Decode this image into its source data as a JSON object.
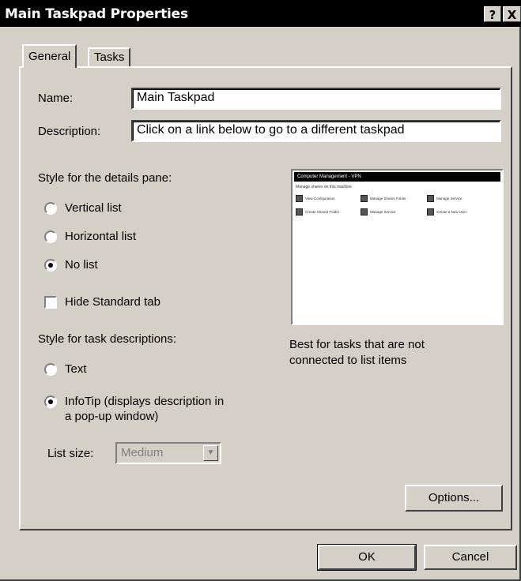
{
  "window": {
    "title": "Main Taskpad Properties",
    "help_label": "?",
    "close_label": "X"
  },
  "tabs": [
    {
      "label": "General",
      "selected": true
    },
    {
      "label": "Tasks",
      "selected": false
    }
  ],
  "name_field": {
    "label": "Name:",
    "value": "Main Taskpad"
  },
  "description_field": {
    "label": "Description:",
    "value": "Click on a link below to go to a different taskpad"
  },
  "details_pane": {
    "heading": "Style for the details pane:",
    "options": [
      {
        "label": "Vertical list",
        "selected": false
      },
      {
        "label": "Horizontal list",
        "selected": false
      },
      {
        "label": "No list",
        "selected": true
      }
    ],
    "hide_standard_tab": {
      "label": "Hide Standard tab",
      "checked": false
    }
  },
  "preview": {
    "title": "Computer Management - VPN",
    "subtitle": "Manage shares on this machine",
    "tasks": [
      "View Configuration",
      "Manage Shares Folder",
      "Manage Service",
      "Create Shared Folder",
      "Manage Service",
      "Create a New User"
    ],
    "caption_line1": "Best for tasks that are not",
    "caption_line2": "connected to list items"
  },
  "task_descriptions": {
    "heading": "Style for task descriptions:",
    "options": [
      {
        "label": "Text",
        "selected": false
      },
      {
        "label_line1": "InfoTip (displays description in",
        "label_line2": "a pop-up window)",
        "selected": true
      }
    ]
  },
  "list_size": {
    "label": "List size:",
    "value": "Medium",
    "enabled": false
  },
  "buttons": {
    "options": "Options...",
    "ok": "OK",
    "cancel": "Cancel"
  }
}
